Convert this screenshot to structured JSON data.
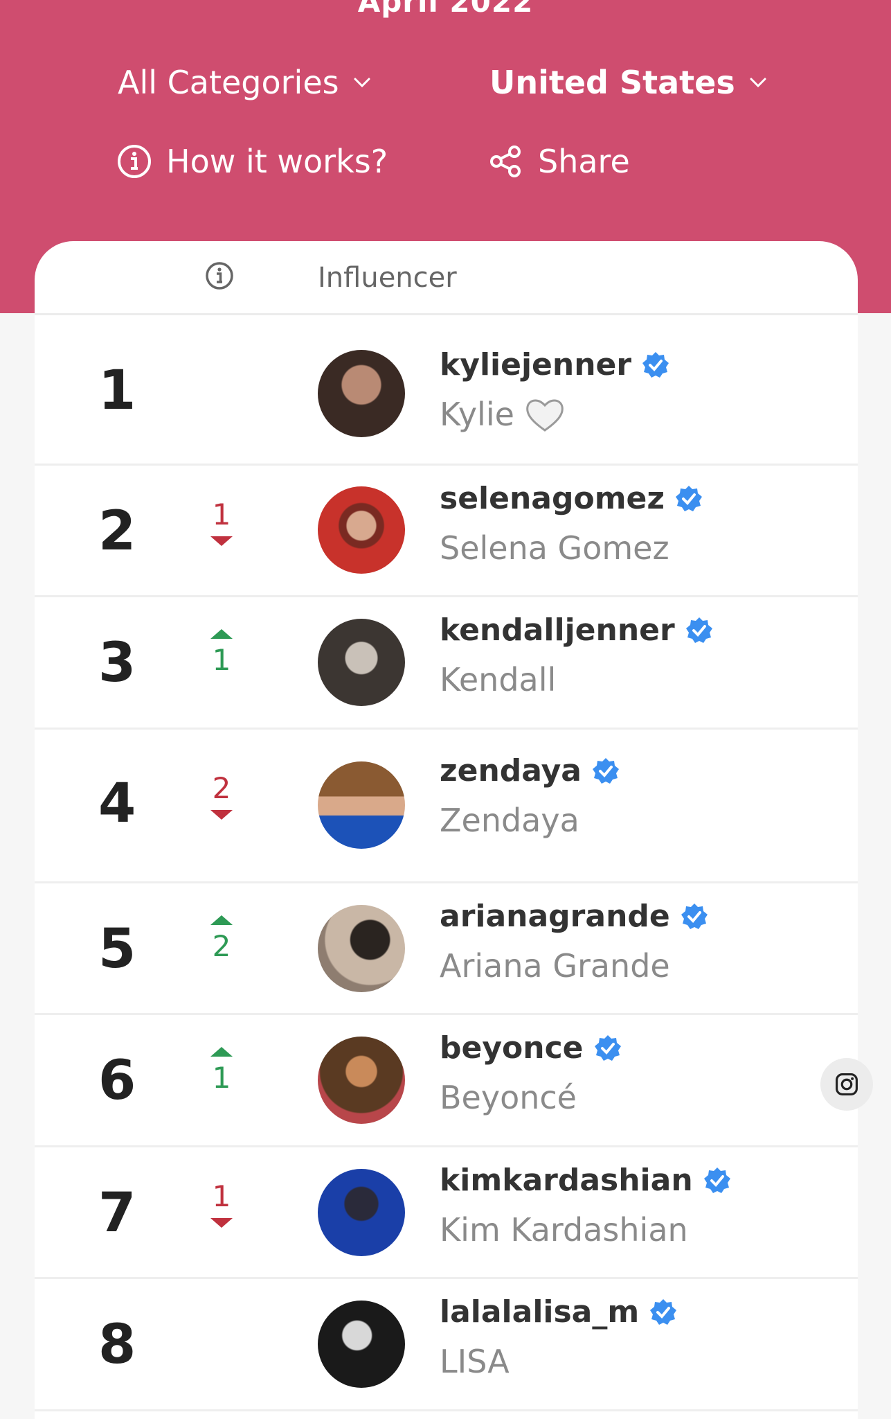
{
  "header": {
    "period": "April 2022",
    "category_label": "All Categories",
    "country_label": "United States",
    "how_label": "How it works?",
    "share_label": "Share"
  },
  "table": {
    "column_influencer": "Influencer"
  },
  "rows": [
    {
      "rank": "1",
      "change": "",
      "direction": "none",
      "username": "kyliejenner",
      "name": "Kylie"
    },
    {
      "rank": "2",
      "change": "1",
      "direction": "down",
      "username": "selenagomez",
      "name": "Selena Gomez"
    },
    {
      "rank": "3",
      "change": "1",
      "direction": "up",
      "username": "kendalljenner",
      "name": "Kendall"
    },
    {
      "rank": "4",
      "change": "2",
      "direction": "down",
      "username": "zendaya",
      "name": "Zendaya"
    },
    {
      "rank": "5",
      "change": "2",
      "direction": "up",
      "username": "arianagrande",
      "name": "Ariana Grande"
    },
    {
      "rank": "6",
      "change": "1",
      "direction": "up",
      "username": "beyonce",
      "name": "Beyoncé"
    },
    {
      "rank": "7",
      "change": "1",
      "direction": "down",
      "username": "kimkardashian",
      "name": "Kim Kardashian"
    },
    {
      "rank": "8",
      "change": "",
      "direction": "none",
      "username": "lalalalisa_m",
      "name": "LISA"
    }
  ],
  "colors": {
    "brand": "#cf4d6f",
    "rank_up": "#2e9a55",
    "rank_down": "#c0313e",
    "verified": "#3b8ff0"
  },
  "icons": {
    "verified": "verified-badge-icon",
    "instagram": "instagram-icon",
    "share": "share-icon",
    "info": "info-icon",
    "chevron": "chevron-down-icon"
  }
}
